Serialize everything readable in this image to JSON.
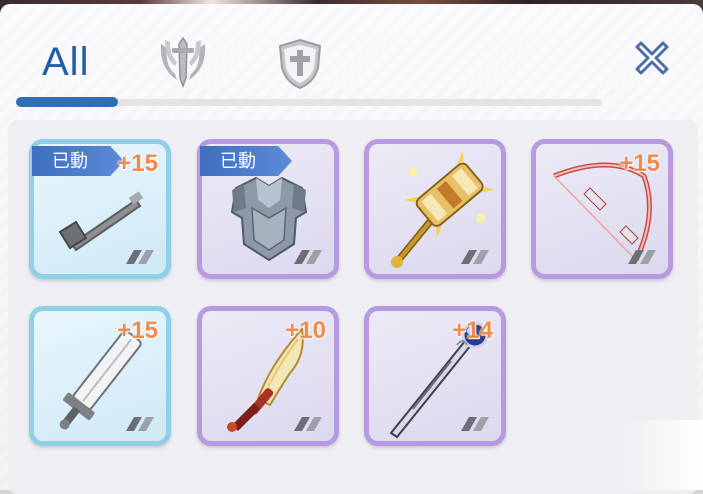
{
  "tabs": {
    "all_label": "All",
    "weapon_icon": "sword-crest-icon",
    "armor_icon": "shield-cross-icon",
    "active_index": 0
  },
  "close_icon": "close-icon",
  "colors": {
    "accent": "#2d6fb6",
    "blue_frame": "#8fd0e6",
    "purple_frame": "#b89ae0",
    "refine": "#ef8a4a",
    "equipped_badge": "#3f6fc0"
  },
  "items": [
    {
      "name": "hammer-weapon",
      "refine": "+15",
      "equipped": "已動",
      "rarity": "blue"
    },
    {
      "name": "armor-chestplate",
      "refine": "",
      "equipped": "已動",
      "rarity": "purple"
    },
    {
      "name": "golden-mace",
      "refine": "",
      "equipped": "",
      "rarity": "purple"
    },
    {
      "name": "crimson-bow",
      "refine": "+15",
      "equipped": "",
      "rarity": "purple"
    },
    {
      "name": "great-sword",
      "refine": "+15",
      "equipped": "",
      "rarity": "blue"
    },
    {
      "name": "flame-dagger",
      "refine": "+10",
      "equipped": "",
      "rarity": "purple"
    },
    {
      "name": "orb-staff",
      "refine": "+14",
      "equipped": "",
      "rarity": "purple"
    }
  ]
}
